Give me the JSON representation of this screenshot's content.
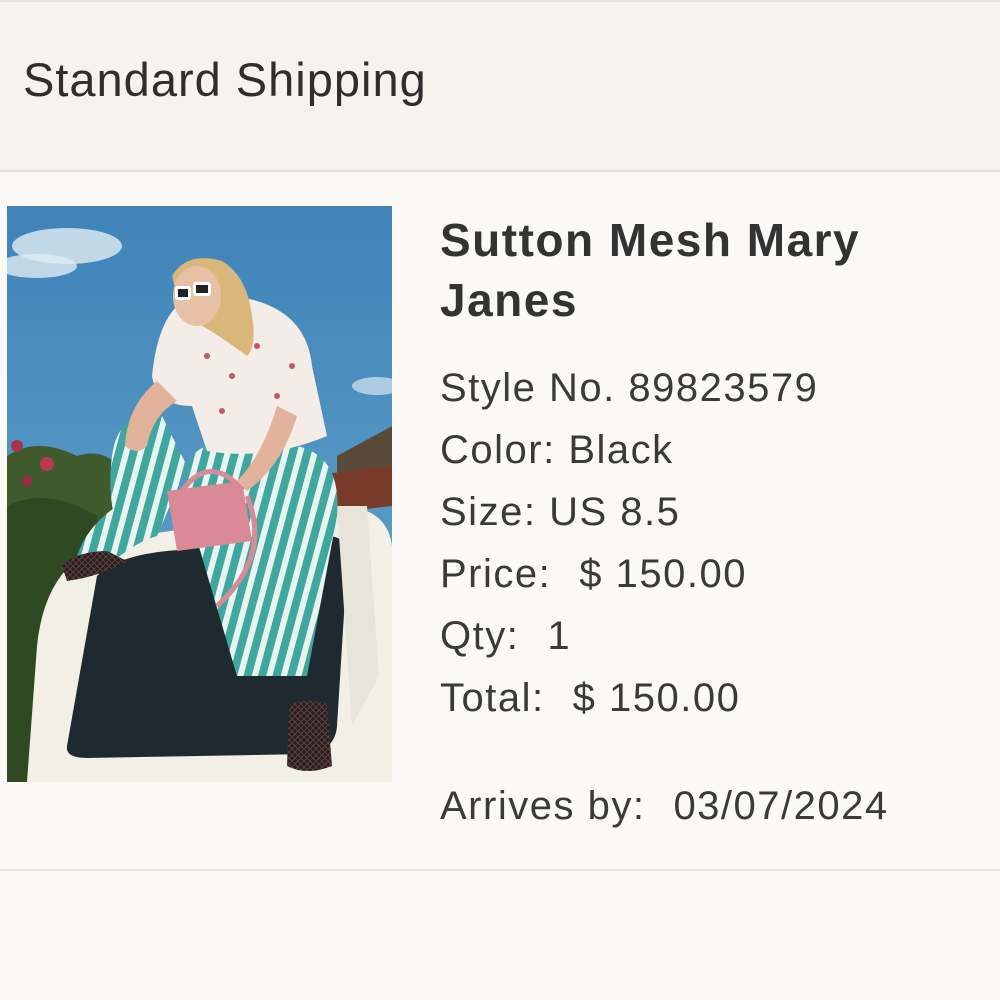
{
  "shipping": {
    "title": "Standard Shipping"
  },
  "product": {
    "name": "Sutton Mesh Mary Janes",
    "image_alt": "Woman in striped pants and mesh mary janes sitting on a white car",
    "style": {
      "label": "Style No.",
      "value": "89823579"
    },
    "color": {
      "label": "Color:",
      "value": "Black"
    },
    "size": {
      "label": "Size:",
      "value": "US 8.5"
    },
    "price": {
      "label": "Price:",
      "value": "$ 150.00"
    },
    "qty": {
      "label": "Qty:",
      "value": "1"
    },
    "total": {
      "label": "Total:",
      "value": "$ 150.00"
    },
    "arrives": {
      "label": "Arrives by:",
      "value": "03/07/2024"
    }
  }
}
